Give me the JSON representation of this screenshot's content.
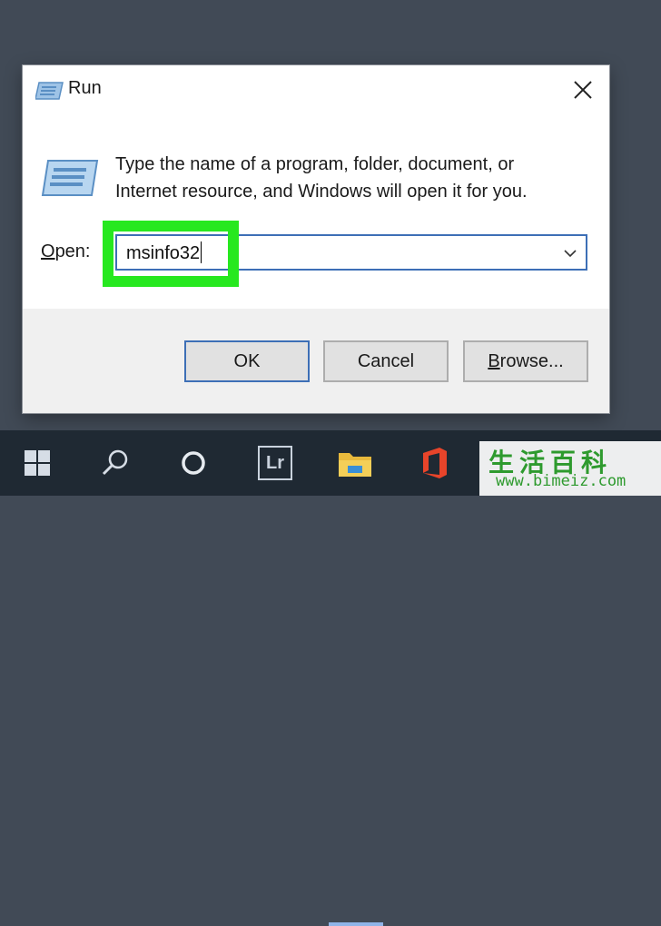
{
  "dialog": {
    "title": "Run",
    "description_line1": "Type the name of a program, folder, document, or",
    "description_line2": "Internet resource, and Windows will open it for you.",
    "open_label_accel": "O",
    "open_label_rest": "pen:",
    "open_value": "msinfo32",
    "buttons": {
      "ok": "OK",
      "cancel": "Cancel",
      "browse_accel": "B",
      "browse_rest": "rowse..."
    }
  },
  "taskbar": {
    "items": [
      "start-icon",
      "search-icon",
      "cortana-icon",
      "lightroom-icon",
      "file-explorer-icon",
      "office-icon"
    ],
    "lightroom_label": "Lr"
  },
  "watermark": {
    "chinese": "生活百科",
    "url": "www.bimeiz.com"
  },
  "colors": {
    "desktop": "#414a56",
    "taskbar": "#1f2933",
    "highlight": "#27e81f",
    "focus_border": "#3d6fb6"
  }
}
